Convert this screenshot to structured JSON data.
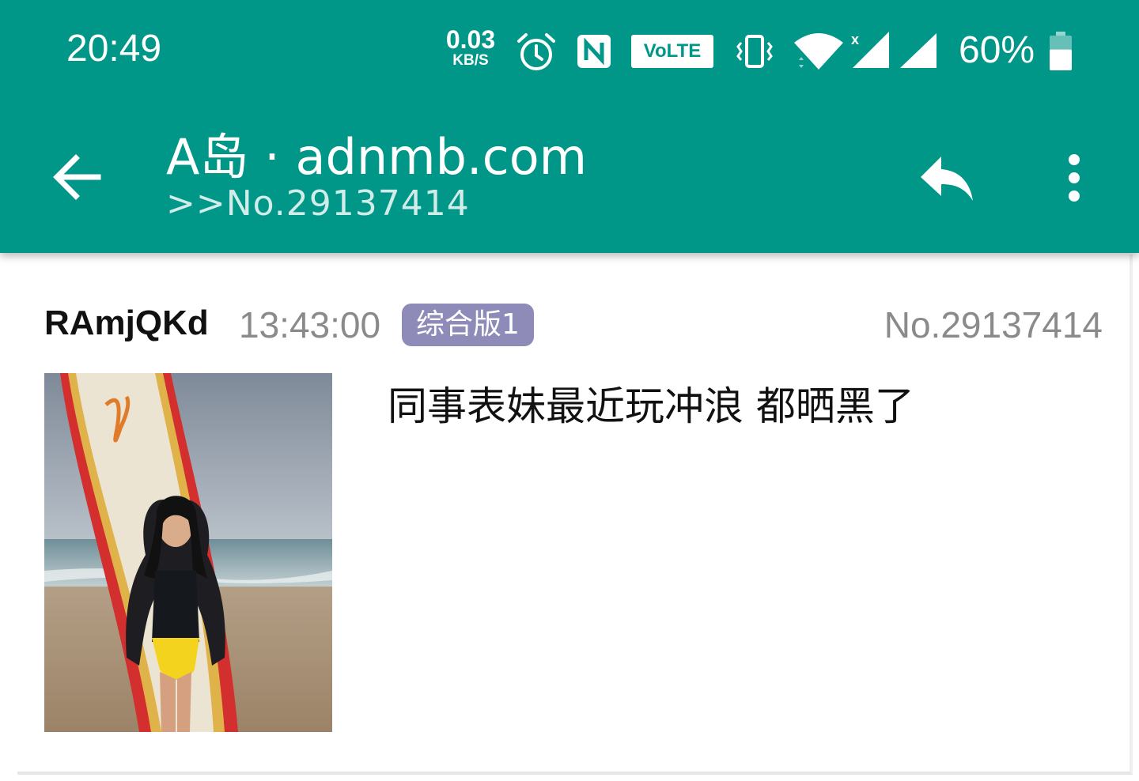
{
  "status_bar": {
    "time": "20:49",
    "net_speed_value": "0.03",
    "net_speed_unit": "KB/S",
    "volte_label": "VoLTE",
    "battery_percent": "60%",
    "battery_level": 0.6,
    "icons": [
      "alarm-icon",
      "nfc-icon",
      "volte-icon",
      "vibrate-icon",
      "wifi-icon",
      "signal-icon",
      "signal-icon-2",
      "battery-icon"
    ]
  },
  "app_bar": {
    "title": "A岛 · adnmb.com",
    "subtitle": ">>No.29137414",
    "icons": [
      "back-arrow-icon",
      "reply-icon",
      "more-vert-icon"
    ],
    "background": "#009688"
  },
  "post": {
    "user_id": "RAmjQKd",
    "time": "13:43:00",
    "board": "综合版1",
    "number": "No.29137414",
    "content": "同事表妹最近玩冲浪 都晒黑了",
    "image": "surfer-photo"
  }
}
